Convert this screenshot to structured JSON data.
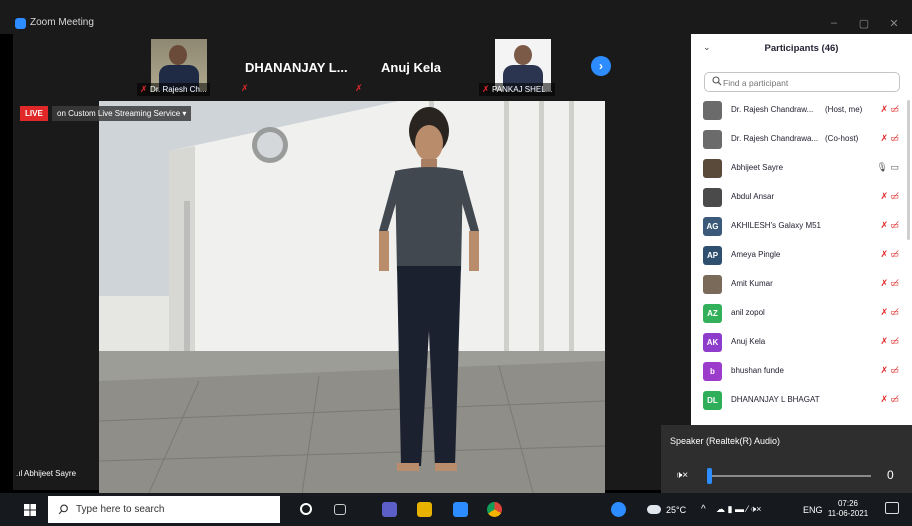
{
  "window": {
    "title": "Zoom Meeting",
    "controls": [
      "–",
      "▢",
      "✕"
    ]
  },
  "gallery": {
    "thumbnails": [
      {
        "name": "Dr. Rajesh Ch...",
        "type": "video"
      },
      {
        "name": "DHANANJAY L...",
        "type": "name"
      },
      {
        "name": "Anuj Kela",
        "type": "name"
      },
      {
        "name": "PANKAJ SHEL...",
        "type": "video"
      }
    ],
    "next_icon": "›"
  },
  "live": {
    "badge": "LIVE",
    "service": "on Custom Live Streaming Service",
    "caret": "▾"
  },
  "video": {
    "speaker_name": "Abhijeet Sayre",
    "signal_icon": "signal-bars-icon"
  },
  "participants": {
    "title": "Participants (46)",
    "collapse_icon": "⌄",
    "search_placeholder": "Find a participant",
    "list": [
      {
        "name": "Dr. Rajesh Chandraw...",
        "role": "(Host, me)",
        "initials": "",
        "color": "#6b6b6b",
        "photo": true,
        "mic": "muted",
        "cam": "off"
      },
      {
        "name": "Dr. Rajesh Chandrawa...",
        "role": "(Co-host)",
        "initials": "",
        "color": "#6b6b6b",
        "photo": true,
        "mic": "muted",
        "cam": "off"
      },
      {
        "name": "Abhijeet Sayre",
        "role": "",
        "initials": "",
        "color": "#5a4a3a",
        "photo": true,
        "mic": "on",
        "cam": "on"
      },
      {
        "name": "Abdul Ansar",
        "role": "",
        "initials": "",
        "color": "#4a4a4a",
        "photo": true,
        "mic": "muted",
        "cam": "off"
      },
      {
        "name": "AKHILESH's Galaxy M51",
        "role": "",
        "initials": "AG",
        "color": "#3b5a7a",
        "photo": false,
        "mic": "muted",
        "cam": "off"
      },
      {
        "name": "Ameya Pingle",
        "role": "",
        "initials": "AP",
        "color": "#2f4f6f",
        "photo": false,
        "mic": "muted",
        "cam": "off"
      },
      {
        "name": "Amit Kumar",
        "role": "",
        "initials": "",
        "color": "#7a6a5a",
        "photo": true,
        "mic": "muted",
        "cam": "off"
      },
      {
        "name": "anil zopol",
        "role": "",
        "initials": "AZ",
        "color": "#33b15a",
        "photo": false,
        "mic": "muted",
        "cam": "off"
      },
      {
        "name": "Anuj Kela",
        "role": "",
        "initials": "AK",
        "color": "#8e3ccb",
        "photo": false,
        "mic": "muted",
        "cam": "off"
      },
      {
        "name": "bhushan funde",
        "role": "",
        "initials": "b",
        "color": "#9b3ccb",
        "photo": false,
        "mic": "muted",
        "cam": "off"
      },
      {
        "name": "DHANANJAY L BHAGAT",
        "role": "",
        "initials": "DL",
        "color": "#2fae5a",
        "photo": false,
        "mic": "muted",
        "cam": "off"
      }
    ]
  },
  "speaker_popup": {
    "title": "Speaker (Realtek(R) Audio)",
    "volume": 0,
    "volume_label": "0"
  },
  "taskbar": {
    "search_placeholder": "Type here to search",
    "weather": "25°C",
    "language": "ENG",
    "time": "07:26",
    "date": "11-06-2021"
  },
  "colors": {
    "accent": "#2d8cff",
    "muted_red": "#e02828",
    "live_red": "#e02828"
  }
}
